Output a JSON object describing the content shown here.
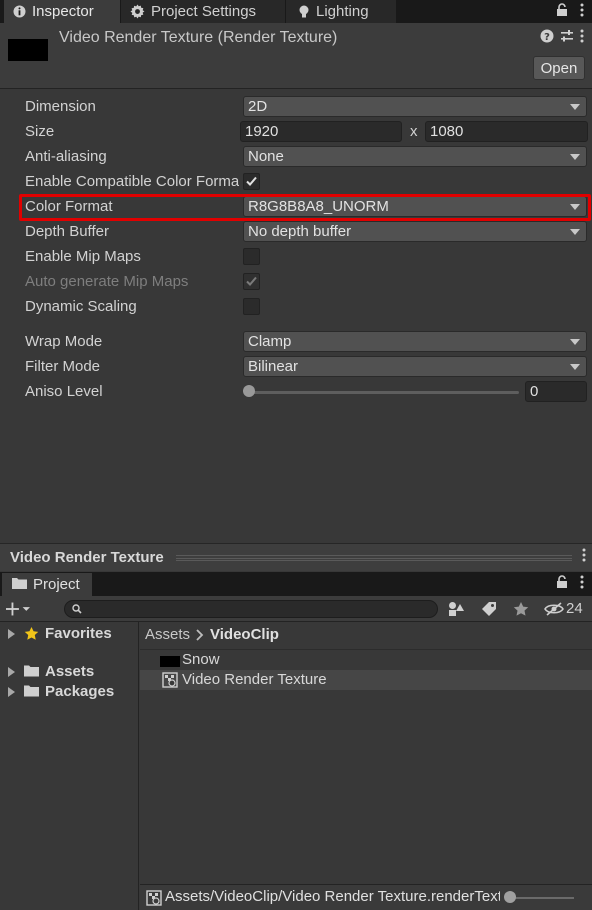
{
  "tabs": [
    {
      "label": "Inspector",
      "icon": "info-icon",
      "active": true
    },
    {
      "label": "Project Settings",
      "icon": "gear-icon",
      "active": false
    },
    {
      "label": "Lighting",
      "icon": "bulb-icon",
      "active": false
    }
  ],
  "inspector": {
    "title": "Video Render Texture (Render Texture)",
    "open_label": "Open",
    "properties": {
      "dimension": {
        "label": "Dimension",
        "value": "2D"
      },
      "size": {
        "label": "Size",
        "width": "1920",
        "x": "x",
        "height": "1080"
      },
      "anti_aliasing": {
        "label": "Anti-aliasing",
        "value": "None"
      },
      "compatible_color": {
        "label": "Enable Compatible Color Format",
        "checked": true
      },
      "color_format": {
        "label": "Color Format",
        "value": "R8G8B8A8_UNORM"
      },
      "depth_buffer": {
        "label": "Depth Buffer",
        "value": "No depth buffer"
      },
      "mip_maps": {
        "label": "Enable Mip Maps",
        "checked": false
      },
      "auto_mip": {
        "label": "Auto generate Mip Maps",
        "checked": true,
        "disabled": true
      },
      "dynamic_scaling": {
        "label": "Dynamic Scaling",
        "checked": false
      },
      "wrap_mode": {
        "label": "Wrap Mode",
        "value": "Clamp"
      },
      "filter_mode": {
        "label": "Filter Mode",
        "value": "Bilinear"
      },
      "aniso_level": {
        "label": "Aniso Level",
        "value": "0",
        "slider_fraction": 0
      }
    }
  },
  "preview": {
    "title": "Video Render Texture"
  },
  "project": {
    "tab_label": "Project",
    "hidden_count": "24",
    "tree": {
      "favorites": "Favorites",
      "assets": "Assets",
      "packages": "Packages"
    },
    "breadcrumb": {
      "root": "Assets",
      "current": "VideoClip"
    },
    "files": [
      {
        "label": "Snow",
        "icon": "black-texture-icon",
        "selected": false
      },
      {
        "label": "Video Render Texture",
        "icon": "render-texture-icon",
        "selected": true
      }
    ],
    "status_path": "Assets/VideoClip/Video Render Texture.renderTexture"
  },
  "colors": {
    "highlight": "#e10000",
    "background": "#383838",
    "favorite_star": "#f0c419"
  }
}
